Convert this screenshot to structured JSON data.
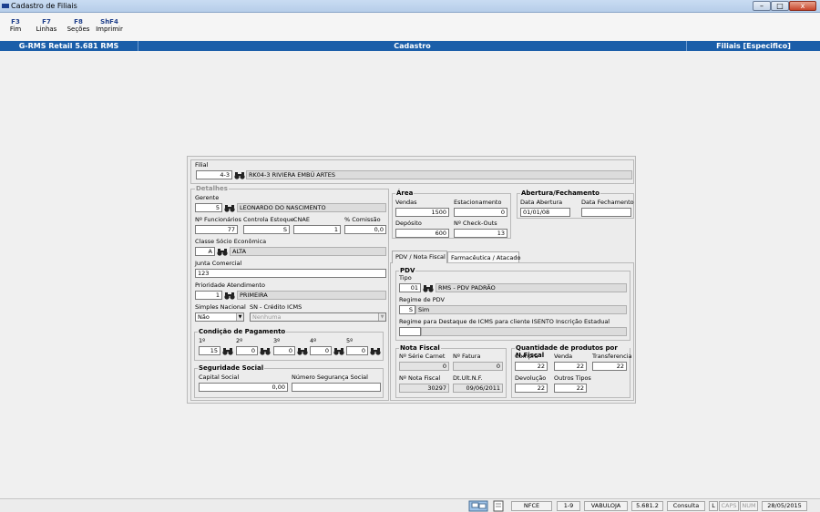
{
  "window": {
    "title": "Cadastro de Filiais",
    "controls": {
      "minimize": "–",
      "maximize": "□",
      "close": "x"
    }
  },
  "toolbar": {
    "keys": [
      {
        "key": "F3",
        "label": "Fim"
      },
      {
        "key": "F7",
        "label": "Linhas"
      },
      {
        "key": "F8",
        "label": "Seções"
      },
      {
        "key": "ShF4",
        "label": "Imprimir"
      }
    ]
  },
  "banner": {
    "left": "G-RMS Retail 5.681 RMS",
    "center": "Cadastro",
    "right": "Filiais [Especifico]"
  },
  "filial": {
    "label": "Filial",
    "code": "4-3",
    "name": "RK04-3 RIVIERA EMBÚ ARTES"
  },
  "detalhes": {
    "legend": "Detalhes",
    "gerente": {
      "label": "Gerente",
      "code": "5",
      "name": "LEONARDO DO NASCIMENTO"
    },
    "funcionarios": {
      "label": "Nº Funcionários",
      "value": "77"
    },
    "controle": {
      "label": "Controla Estoque",
      "value": "S"
    },
    "cnae": {
      "label": "CNAE",
      "value": "1"
    },
    "comissao": {
      "label": "% Comissão",
      "value": "0,0"
    },
    "classe": {
      "label": "Classe Sócio Econômica",
      "code": "A",
      "name": "ALTA"
    },
    "junta": {
      "label": "Junta Comercial",
      "value": "123"
    },
    "prioridade": {
      "label": "Prioridade Atendimento",
      "code": "1",
      "name": "PRIMEIRA"
    },
    "simples": {
      "label": "Simples Nacional",
      "value": "Não"
    },
    "sn_credito": {
      "label": "SN - Crédito ICMS",
      "value": "Nenhuma"
    },
    "condicao": {
      "legend": "Condição de Pagamento",
      "cols": [
        {
          "label": "1º",
          "value": "15"
        },
        {
          "label": "2º",
          "value": "0"
        },
        {
          "label": "3º",
          "value": "0"
        },
        {
          "label": "4º",
          "value": "0"
        },
        {
          "label": "5º",
          "value": "0"
        }
      ]
    },
    "seguridade": {
      "legend": "Seguridade Social",
      "capital_label": "Capital Social",
      "capital_value": "0,00",
      "numero_label": "Número Segurança Social",
      "numero_value": ""
    }
  },
  "area": {
    "legend": "Área",
    "vendas_label": "Vendas",
    "vendas": "1500",
    "estac_label": "Estacionamento",
    "estac": "0",
    "deposito_label": "Depósito",
    "deposito": "600",
    "checkouts_label": "Nº Check-Outs",
    "checkouts": "13"
  },
  "abertura": {
    "legend": "Abertura/Fechamento",
    "abertura_label": "Data Abertura",
    "abertura": "01/01/08",
    "fechamento_label": "Data Fechamento",
    "fechamento": ""
  },
  "tabs": [
    {
      "label": "PDV / Nota Fiscal"
    },
    {
      "label": "Farmacêutica / Atacado"
    }
  ],
  "pdv": {
    "legend": "PDV",
    "tipo_label": "Tipo",
    "tipo_code": "01",
    "tipo_name": "RMS - PDV PADRÃO",
    "regime_label": "Regime de PDV",
    "regime_code": "S",
    "regime_name": "Sim",
    "destaque_label": "Regime para Destaque de ICMS para cliente ISENTO Inscrição Estadual",
    "destaque_value": ""
  },
  "nota_fiscal": {
    "legend": "Nota Fiscal",
    "serie_label": "Nº Série Carnet",
    "serie": "0",
    "fatura_label": "Nº Fatura",
    "fatura": "0",
    "nota_label": "Nº Nota Fiscal",
    "nota": "30297",
    "dt_label": "Dt.Ult.N.F.",
    "dt": "09/06/2011"
  },
  "quantidade": {
    "legend": "Quantidade de produtos por N.Fiscal",
    "compra_label": "Compra",
    "compra": "22",
    "venda_label": "Venda",
    "venda": "22",
    "transf_label": "Transferencia",
    "transf": "22",
    "devolucao_label": "Devolução",
    "devolucao": "22",
    "outros_label": "Outros Tipos",
    "outros": "22"
  },
  "status": {
    "items": [
      "NFCE",
      "1-9",
      "VABULOJA",
      "5.681.2",
      "Consulta",
      "L",
      "CAPS",
      "NUM",
      "28/05/2015"
    ]
  },
  "colors": {
    "banner": "#1b5ea9",
    "key": "#1f3f8a"
  }
}
